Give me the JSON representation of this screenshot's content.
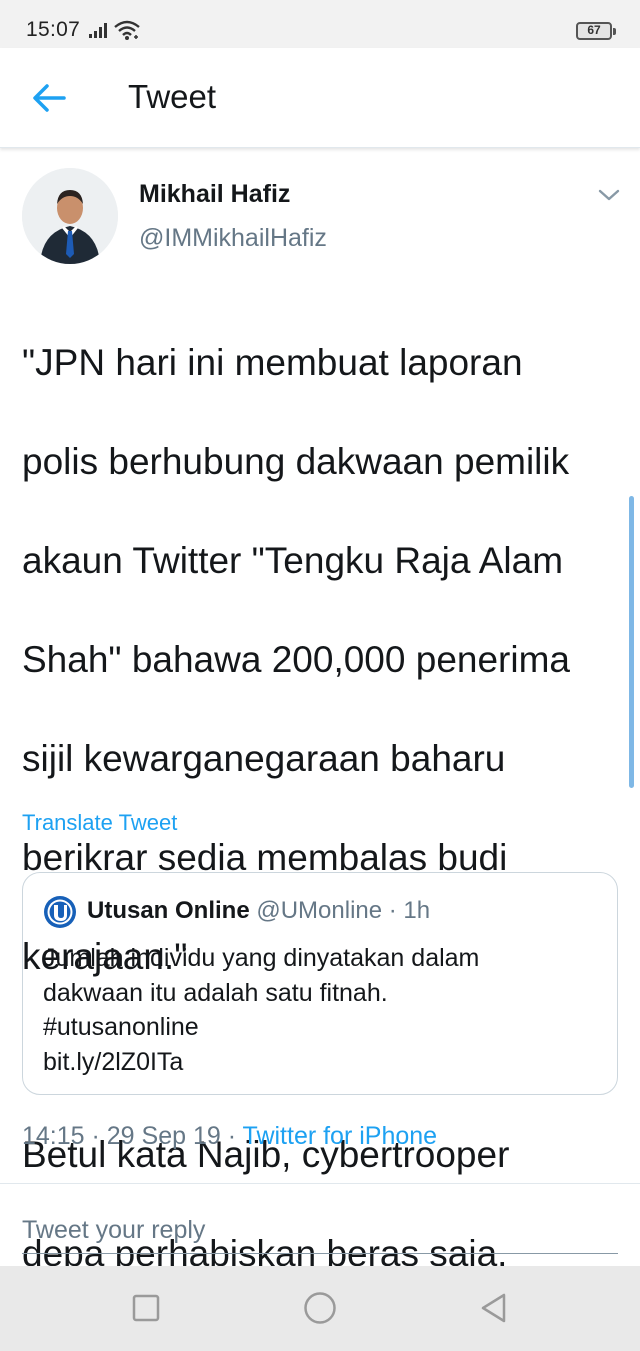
{
  "status_bar": {
    "time": "15:07",
    "battery": "67",
    "icons": [
      "signal-icon",
      "wifi-icon",
      "battery-icon"
    ]
  },
  "header": {
    "back_icon": "arrow-left-icon",
    "title": "Tweet"
  },
  "tweet": {
    "author_name": "Mikhail Hafiz",
    "author_handle": "@IMMikhailHafiz",
    "text_lines": [
      "\"JPN hari ini membuat laporan",
      "polis berhubung dakwaan pemilik",
      "akaun Twitter \"Tengku Raja Alam",
      "Shah\" bahawa 200,000 penerima",
      "sijil kewarganegaraan baharu",
      "berikrar sedia membalas budi",
      "kerajaan.\"",
      "",
      "Betul kata Najib, cybertrooper",
      "depa perhabiskan beras saja."
    ],
    "translate_label": "Translate Tweet"
  },
  "quote": {
    "name": "Utusan Online",
    "meta": "@UMonline · 1h",
    "lines": [
      "Jumlah individu yang dinyatakan dalam",
      "dakwaan itu adalah satu fitnah.",
      "#utusanonline",
      "bit.ly/2lZ0ITa"
    ]
  },
  "meta": {
    "time_date": "14:15 · 29 Sep 19 · ",
    "source": "Twitter for iPhone"
  },
  "reply": {
    "placeholder": "Tweet your reply"
  },
  "colors": {
    "accent": "#1da1f2",
    "secondary_text": "#657786",
    "primary_text": "#14171a",
    "border": "#ccd6dd"
  }
}
